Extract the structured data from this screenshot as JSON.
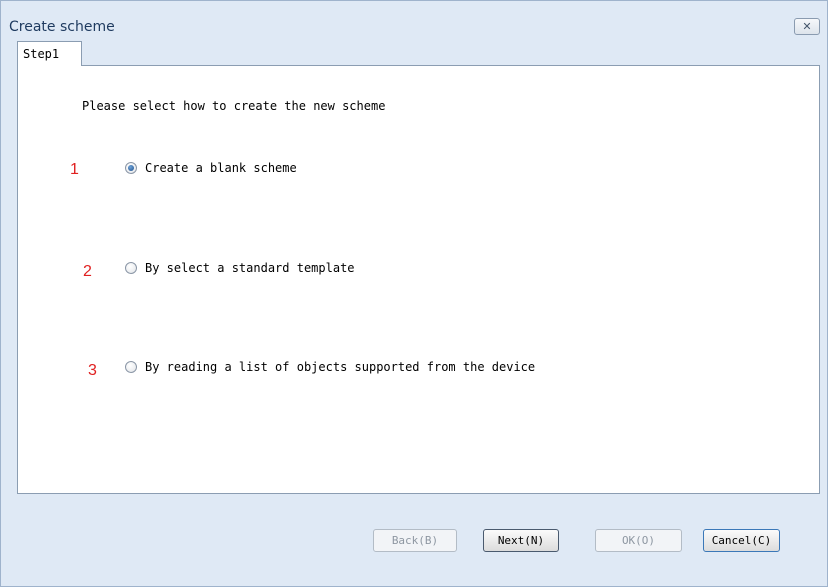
{
  "window": {
    "title": "Create scheme",
    "close_glyph": "✕"
  },
  "tabs": [
    {
      "label": "Step1"
    }
  ],
  "panel": {
    "prompt": "Please select how to create the new scheme",
    "options": [
      {
        "number": "1",
        "label": "Create a blank scheme",
        "checked": true
      },
      {
        "number": "2",
        "label": "By select a standard template",
        "checked": false
      },
      {
        "number": "3",
        "label": "By reading a list of objects supported from the device",
        "checked": false
      }
    ]
  },
  "buttons": {
    "back": {
      "label": "Back(B)",
      "enabled": false
    },
    "next": {
      "label": "Next(N)",
      "enabled": true
    },
    "ok": {
      "label": "OK(O)",
      "enabled": false
    },
    "cancel": {
      "label": "Cancel(C)",
      "enabled": true
    }
  },
  "colors": {
    "window_bg": "#dfe9f5",
    "annotation_red": "#e02020",
    "radio_selected": "#1d4f8c"
  }
}
